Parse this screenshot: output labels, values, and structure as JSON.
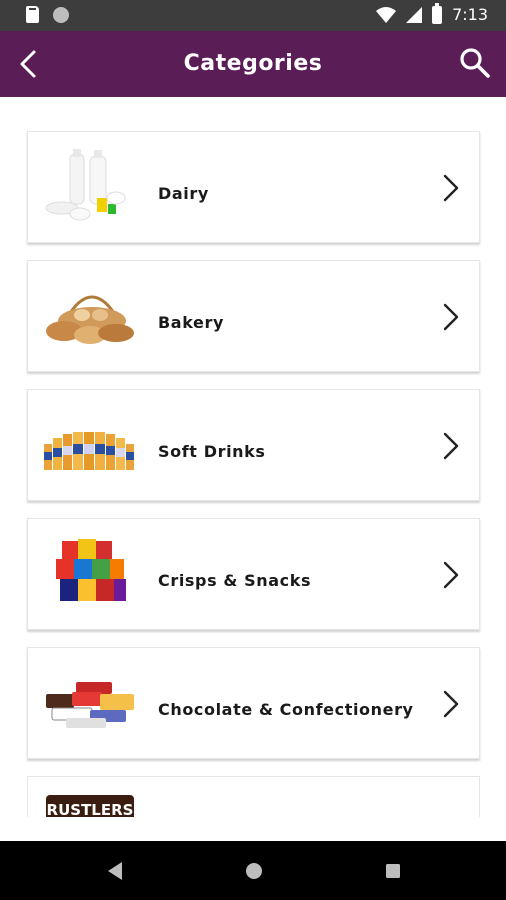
{
  "status_bar": {
    "time": "7:13",
    "icons": [
      "sd-card-icon",
      "circle-icon",
      "wifi-icon",
      "signal-icon",
      "battery-icon"
    ]
  },
  "app_bar": {
    "title": "Categories",
    "back_icon": "back-arrow-icon",
    "search_icon": "search-icon",
    "color": "#5a1d56"
  },
  "categories": [
    {
      "label": "Dairy",
      "thumb": "dairy-image"
    },
    {
      "label": "Bakery",
      "thumb": "bakery-image"
    },
    {
      "label": "Soft Drinks",
      "thumb": "soft-drinks-image"
    },
    {
      "label": "Crisps & Snacks",
      "thumb": "crisps-snacks-image"
    },
    {
      "label": "Chocolate & Confectionery",
      "thumb": "chocolate-image"
    }
  ],
  "partial_card": {
    "logo_text": "RUSTLERS"
  },
  "nav_bar": {
    "buttons": [
      "back-nav-icon",
      "home-nav-icon",
      "recents-nav-icon"
    ]
  }
}
